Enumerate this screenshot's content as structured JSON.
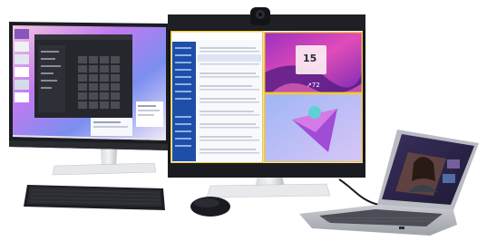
{
  "scene": {
    "left_monitor": {
      "wallpaper_colors": [
        "#f2b6d8",
        "#b75cf0",
        "#5f7dde",
        "#e6eef8"
      ]
    },
    "right_monitor": {
      "panels": {
        "top_right_date": "15",
        "top_right_temp": "↗72"
      },
      "accent_color": "#f0c93b"
    },
    "laptop": {
      "screen_color": "#2b2547"
    }
  }
}
